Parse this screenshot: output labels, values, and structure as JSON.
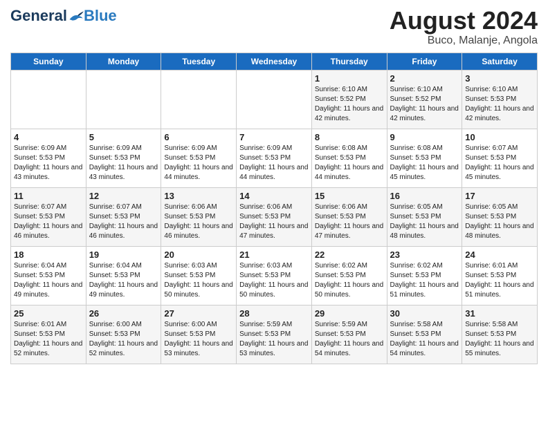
{
  "header": {
    "logo_general": "General",
    "logo_blue": "Blue",
    "title": "August 2024",
    "subtitle": "Buco, Malanje, Angola"
  },
  "days_of_week": [
    "Sunday",
    "Monday",
    "Tuesday",
    "Wednesday",
    "Thursday",
    "Friday",
    "Saturday"
  ],
  "weeks": [
    [
      {
        "day": "",
        "info": ""
      },
      {
        "day": "",
        "info": ""
      },
      {
        "day": "",
        "info": ""
      },
      {
        "day": "",
        "info": ""
      },
      {
        "day": "1",
        "info": "Sunrise: 6:10 AM\nSunset: 5:52 PM\nDaylight: 11 hours and 42 minutes."
      },
      {
        "day": "2",
        "info": "Sunrise: 6:10 AM\nSunset: 5:52 PM\nDaylight: 11 hours and 42 minutes."
      },
      {
        "day": "3",
        "info": "Sunrise: 6:10 AM\nSunset: 5:53 PM\nDaylight: 11 hours and 42 minutes."
      }
    ],
    [
      {
        "day": "4",
        "info": "Sunrise: 6:09 AM\nSunset: 5:53 PM\nDaylight: 11 hours and 43 minutes."
      },
      {
        "day": "5",
        "info": "Sunrise: 6:09 AM\nSunset: 5:53 PM\nDaylight: 11 hours and 43 minutes."
      },
      {
        "day": "6",
        "info": "Sunrise: 6:09 AM\nSunset: 5:53 PM\nDaylight: 11 hours and 44 minutes."
      },
      {
        "day": "7",
        "info": "Sunrise: 6:09 AM\nSunset: 5:53 PM\nDaylight: 11 hours and 44 minutes."
      },
      {
        "day": "8",
        "info": "Sunrise: 6:08 AM\nSunset: 5:53 PM\nDaylight: 11 hours and 44 minutes."
      },
      {
        "day": "9",
        "info": "Sunrise: 6:08 AM\nSunset: 5:53 PM\nDaylight: 11 hours and 45 minutes."
      },
      {
        "day": "10",
        "info": "Sunrise: 6:07 AM\nSunset: 5:53 PM\nDaylight: 11 hours and 45 minutes."
      }
    ],
    [
      {
        "day": "11",
        "info": "Sunrise: 6:07 AM\nSunset: 5:53 PM\nDaylight: 11 hours and 46 minutes."
      },
      {
        "day": "12",
        "info": "Sunrise: 6:07 AM\nSunset: 5:53 PM\nDaylight: 11 hours and 46 minutes."
      },
      {
        "day": "13",
        "info": "Sunrise: 6:06 AM\nSunset: 5:53 PM\nDaylight: 11 hours and 46 minutes."
      },
      {
        "day": "14",
        "info": "Sunrise: 6:06 AM\nSunset: 5:53 PM\nDaylight: 11 hours and 47 minutes."
      },
      {
        "day": "15",
        "info": "Sunrise: 6:06 AM\nSunset: 5:53 PM\nDaylight: 11 hours and 47 minutes."
      },
      {
        "day": "16",
        "info": "Sunrise: 6:05 AM\nSunset: 5:53 PM\nDaylight: 11 hours and 48 minutes."
      },
      {
        "day": "17",
        "info": "Sunrise: 6:05 AM\nSunset: 5:53 PM\nDaylight: 11 hours and 48 minutes."
      }
    ],
    [
      {
        "day": "18",
        "info": "Sunrise: 6:04 AM\nSunset: 5:53 PM\nDaylight: 11 hours and 49 minutes."
      },
      {
        "day": "19",
        "info": "Sunrise: 6:04 AM\nSunset: 5:53 PM\nDaylight: 11 hours and 49 minutes."
      },
      {
        "day": "20",
        "info": "Sunrise: 6:03 AM\nSunset: 5:53 PM\nDaylight: 11 hours and 50 minutes."
      },
      {
        "day": "21",
        "info": "Sunrise: 6:03 AM\nSunset: 5:53 PM\nDaylight: 11 hours and 50 minutes."
      },
      {
        "day": "22",
        "info": "Sunrise: 6:02 AM\nSunset: 5:53 PM\nDaylight: 11 hours and 50 minutes."
      },
      {
        "day": "23",
        "info": "Sunrise: 6:02 AM\nSunset: 5:53 PM\nDaylight: 11 hours and 51 minutes."
      },
      {
        "day": "24",
        "info": "Sunrise: 6:01 AM\nSunset: 5:53 PM\nDaylight: 11 hours and 51 minutes."
      }
    ],
    [
      {
        "day": "25",
        "info": "Sunrise: 6:01 AM\nSunset: 5:53 PM\nDaylight: 11 hours and 52 minutes."
      },
      {
        "day": "26",
        "info": "Sunrise: 6:00 AM\nSunset: 5:53 PM\nDaylight: 11 hours and 52 minutes."
      },
      {
        "day": "27",
        "info": "Sunrise: 6:00 AM\nSunset: 5:53 PM\nDaylight: 11 hours and 53 minutes."
      },
      {
        "day": "28",
        "info": "Sunrise: 5:59 AM\nSunset: 5:53 PM\nDaylight: 11 hours and 53 minutes."
      },
      {
        "day": "29",
        "info": "Sunrise: 5:59 AM\nSunset: 5:53 PM\nDaylight: 11 hours and 54 minutes."
      },
      {
        "day": "30",
        "info": "Sunrise: 5:58 AM\nSunset: 5:53 PM\nDaylight: 11 hours and 54 minutes."
      },
      {
        "day": "31",
        "info": "Sunrise: 5:58 AM\nSunset: 5:53 PM\nDaylight: 11 hours and 55 minutes."
      }
    ]
  ]
}
